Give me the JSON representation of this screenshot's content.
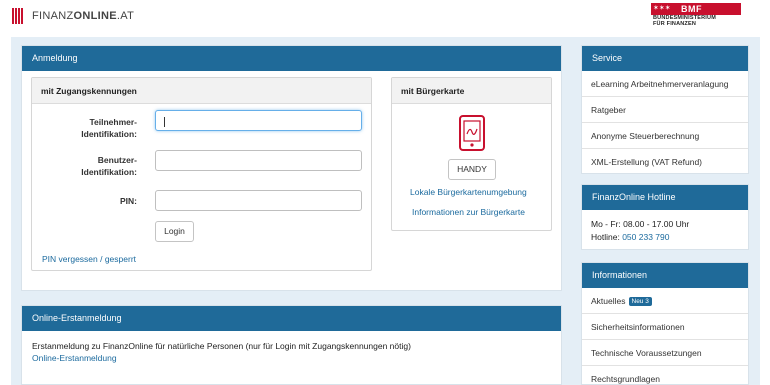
{
  "header": {
    "logo_light": "FINANZ",
    "logo_bold": "ONLINE",
    "logo_suffix": ".AT",
    "ministry_abbr": "BMF",
    "ministry_line1": "BUNDESMINISTERIUM",
    "ministry_line2": "FÜR FINANZEN"
  },
  "login": {
    "title": "Anmeldung",
    "credentials": {
      "title": "mit Zugangskennungen",
      "participant_label_1": "Teilnehmer-",
      "participant_label_2": "Identifikation:",
      "participant_value": "",
      "user_label_1": "Benutzer-",
      "user_label_2": "Identifikation:",
      "user_value": "",
      "pin_label": "PIN:",
      "pin_value": "",
      "login_button": "Login",
      "forgot_link": "PIN vergessen / gesperrt"
    },
    "citizen_card": {
      "title": "mit Bürgerkarte",
      "phone_icon": "mobile-signature-icon",
      "handy_button": "HANDY",
      "local_link": "Lokale Bürgerkartenumgebung",
      "info_link": "Informationen zur Bürgerkarte"
    }
  },
  "registration": {
    "title": "Online-Erstanmeldung",
    "text": "Erstanmeldung zu FinanzOnline für natürliche Personen (nur für Login mit Zugangskennungen nötig)",
    "link": "Online-Erstanmeldung"
  },
  "service": {
    "title": "Service",
    "items": [
      {
        "label": "eLearning Arbeitnehmerveranlagung"
      },
      {
        "label": "Ratgeber"
      },
      {
        "label": "Anonyme Steuerberechnung"
      },
      {
        "label": "XML-Erstellung (VAT Refund)"
      }
    ]
  },
  "hotline": {
    "title": "FinanzOnline Hotline",
    "hours": "Mo - Fr: 08.00 - 17.00 Uhr",
    "phone_label": "Hotline:",
    "phone_number": "050 233 790"
  },
  "information": {
    "title": "Informationen",
    "items": [
      {
        "label": "Aktuelles",
        "badge": "Neu 3"
      },
      {
        "label": "Sicherheitsinformationen"
      },
      {
        "label": "Technische Voraussetzungen"
      },
      {
        "label": "Rechtsgrundlagen"
      }
    ]
  },
  "colors": {
    "brand_red": "#c8102e",
    "header_blue": "#1f6a99",
    "link_blue": "#1b6a9e",
    "page_bg": "#e4eef6"
  }
}
